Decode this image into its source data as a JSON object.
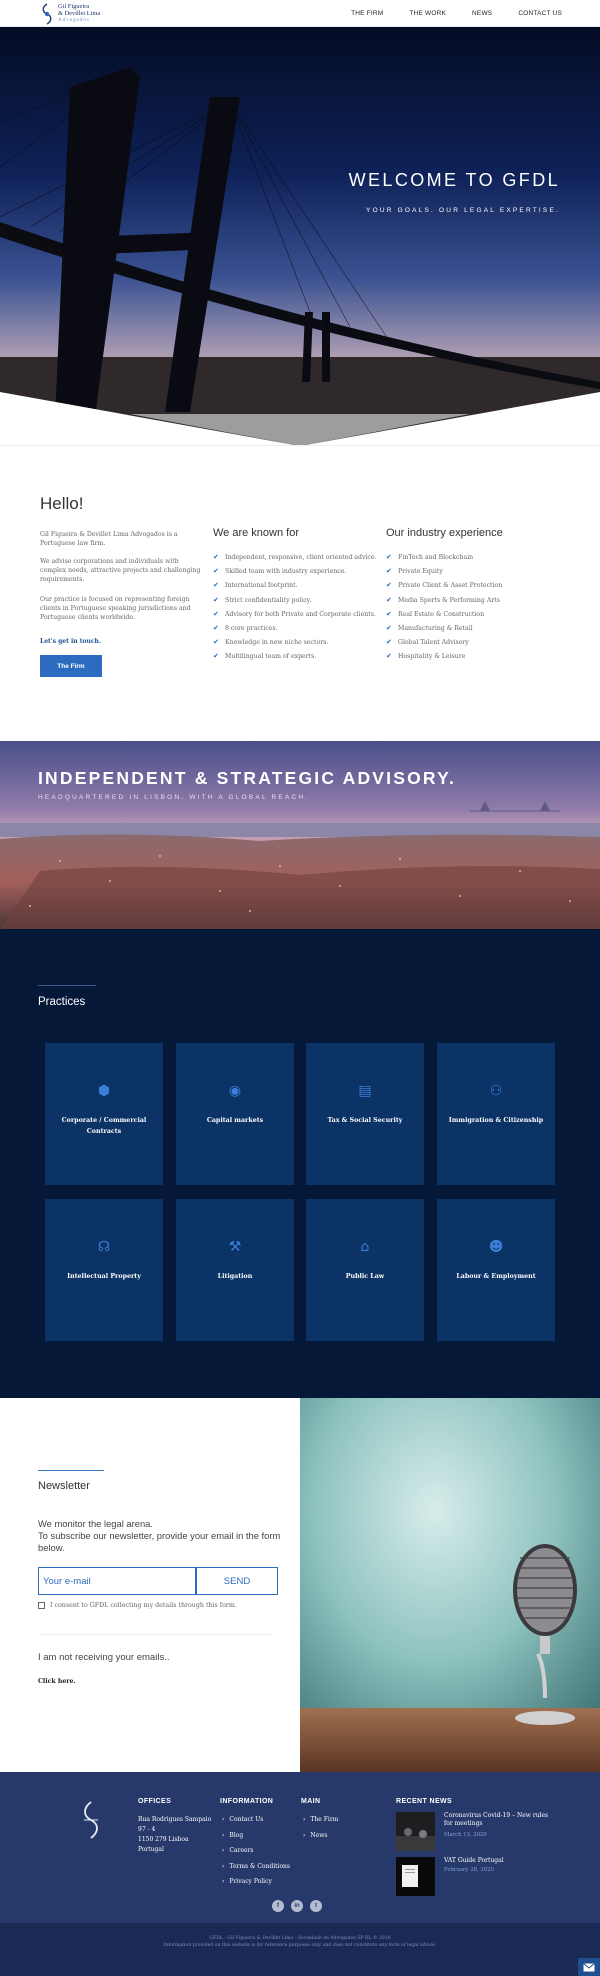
{
  "header": {
    "logo_line1": "Gil Figueira",
    "logo_line2": "& Devillet Lima",
    "logo_line3": "Advogados",
    "nav": [
      "THE FIRM",
      "THE WORK",
      "NEWS",
      "CONTACT US"
    ]
  },
  "hero": {
    "title": "WELCOME TO GFDL",
    "subtitle": "YOUR GOALS. OUR LEGAL EXPERTISE."
  },
  "intro": {
    "hello": "Hello!",
    "p1": "Gil Figueira & Devillet Lima Advogados is a Portuguese law firm.",
    "p2": "We advise corporations and individuals with complex needs, attractive projects and challenging requirements.",
    "p3": "Our practice is focused on representing foreign clients in Portuguese speaking jurisdictions and Portuguese clients worldwide.",
    "get_in_touch": "Let's get in touch.",
    "button": "The Firm"
  },
  "known_for": {
    "title": "We are known for",
    "items": [
      "Independent, responsive, client oriented advice.",
      "Skilled team with industry experience.",
      "International footprint.",
      "Strict confidentiality policy.",
      "Advisory for both Private and Corporate clients.",
      "8 core practices.",
      "Knowledge in new niche sectors.",
      "Multilingual team of experts."
    ]
  },
  "industry": {
    "title": "Our industry experience",
    "items": [
      "FinTech and Blockchain",
      "Private Equity",
      "Private Client & Asset Protection",
      "Media Sports & Performing Arts",
      "Real Estate & Construction",
      "Manufacturing & Retail",
      "Global Talent Advisory",
      "Hospitality & Leisure"
    ]
  },
  "advisory": {
    "title": "INDEPENDENT & STRATEGIC ADVISORY.",
    "subtitle": "HEADQUARTERED IN LISBON. WITH A GLOBAL REACH."
  },
  "practices": {
    "title": "Practices",
    "cards": [
      {
        "label": "Corporate / Commercial Contracts",
        "icon": "cubes-icon"
      },
      {
        "label": "Capital markets",
        "icon": "compass-icon"
      },
      {
        "label": "Tax & Social Security",
        "icon": "money-icon"
      },
      {
        "label": "Immigration & Citizenship",
        "icon": "people-icon"
      },
      {
        "label": "Intellectual Property",
        "icon": "brain-icon"
      },
      {
        "label": "Litigation",
        "icon": "gavel-icon"
      },
      {
        "label": "Public Law",
        "icon": "institution-icon"
      },
      {
        "label": "Labour & Employment",
        "icon": "group-icon"
      }
    ]
  },
  "newsletter": {
    "title": "Newsletter",
    "text1": "We monitor the legal arena.",
    "text2": "To subscribe our newsletter, provide your email in the form below.",
    "email_placeholder": "Your e-mail",
    "send": "SEND",
    "consent": "I consent to GFDL collecting my details through this form.",
    "not_receiving": "I am not receiving your emails..",
    "click_here": "Click here."
  },
  "footer": {
    "offices_title": "OFFICES",
    "address": [
      "Rua Rodrigues Sampaio",
      "97 - 4",
      "1150 279 Lisboa",
      "Portugal"
    ],
    "information_title": "INFORMATION",
    "information": [
      "Contact Us",
      "Blog",
      "Careers",
      "Terms & Conditions",
      "Privacy Policy"
    ],
    "main_title": "MAIN",
    "main": [
      "The Firm",
      "News"
    ],
    "recent_title": "RECENT NEWS",
    "news": [
      {
        "title": "Coronavirus Covid-19 – New rules for meetings",
        "date": "March 13, 2020"
      },
      {
        "title": "VAT Guide Portugal",
        "date": "February 28, 2020"
      }
    ],
    "socials": [
      "f",
      "in",
      "t"
    ],
    "copyright1": "GFDL - Gil Figueira & Devillet Lima - Sociedade de Advogados SP RL © 2020",
    "copyright2": "Information provided on this website is for reference purposes only and does not constitute any form of legal advice."
  }
}
